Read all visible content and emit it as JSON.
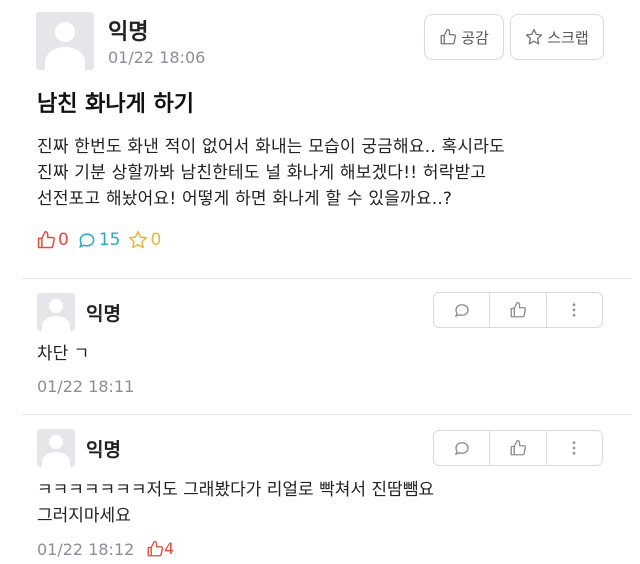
{
  "post": {
    "author": "익명",
    "timestamp": "01/22 18:06",
    "buttons": {
      "empathy": "공감",
      "scrap": "스크랩"
    },
    "title": "남친 화나게 하기",
    "content_lines": [
      "진짜 한번도 화낸 적이 없어서 화내는 모습이 궁금해요.. 혹시라도",
      "진짜 기분 상할까봐 남친한테도 널 화나게 해보겠다!! 허락받고",
      "선전포고 해놨어요! 어떻게 하면 화나게 할 수 있을까요..?"
    ],
    "stats": {
      "likes": "0",
      "comments": "15",
      "scraps": "0"
    }
  },
  "comments": [
    {
      "author": "익명",
      "lines": [
        "차단 ㄱ"
      ],
      "timestamp": "01/22 18:11",
      "likes": ""
    },
    {
      "author": "익명",
      "lines": [
        "ㅋㅋㅋㅋㅋㅋㅋ저도 그래봤다가 리얼로 빡쳐서 진땀뺌요",
        "그러지마세요"
      ],
      "timestamp": "01/22 18:12",
      "likes": "4"
    }
  ],
  "colors": {
    "like": "#e24a3b",
    "comment": "#2aa6c7",
    "scrap": "#e7b73a",
    "muted": "#8a8f96",
    "border": "#d7dbe0"
  },
  "icons": [
    "thumbs-up-icon",
    "star-icon",
    "comment-bubble-icon",
    "more-vertical-icon",
    "avatar-placeholder"
  ]
}
